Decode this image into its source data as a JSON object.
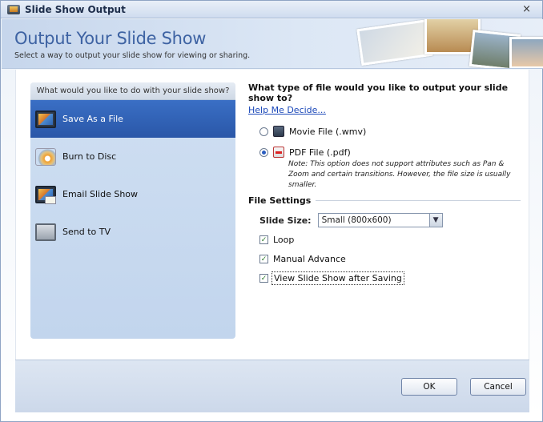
{
  "window": {
    "title": "Slide Show Output",
    "close_glyph": "×"
  },
  "header": {
    "title": "Output Your Slide Show",
    "subtitle": "Select a way to output your slide show for viewing or sharing."
  },
  "sidebar": {
    "heading": "What would you like to do with your slide show?",
    "items": [
      {
        "label": "Save As a File",
        "icon": "monitor-icon",
        "selected": true
      },
      {
        "label": "Burn to Disc",
        "icon": "disc-icon",
        "selected": false
      },
      {
        "label": "Email Slide Show",
        "icon": "email-icon",
        "selected": false
      },
      {
        "label": "Send to TV",
        "icon": "tv-icon",
        "selected": false
      }
    ]
  },
  "output": {
    "question": "What type of file would you like to output your slide show to?",
    "help_link": "Help Me Decide...",
    "options": [
      {
        "label": "Movie File (.wmv)",
        "icon": "wmv-file-icon",
        "selected": false
      },
      {
        "label": "PDF File (.pdf)",
        "icon": "pdf-file-icon",
        "selected": true
      }
    ],
    "note": "Note: This option does not support attributes such as Pan & Zoom and certain transitions. However, the file size is usually smaller."
  },
  "file_settings": {
    "heading": "File Settings",
    "slide_size_label": "Slide Size:",
    "slide_size_value": "Small (800x600)",
    "checkboxes": [
      {
        "label": "Loop",
        "checked": true
      },
      {
        "label": "Manual Advance",
        "checked": true
      },
      {
        "label": "View Slide Show after Saving",
        "checked": true
      }
    ],
    "check_glyph": "✓"
  },
  "buttons": {
    "ok": "OK",
    "cancel": "Cancel"
  },
  "colors": {
    "accent": "#3e63a3",
    "selected_nav": "#2f62b8",
    "link": "#1a47b8"
  }
}
